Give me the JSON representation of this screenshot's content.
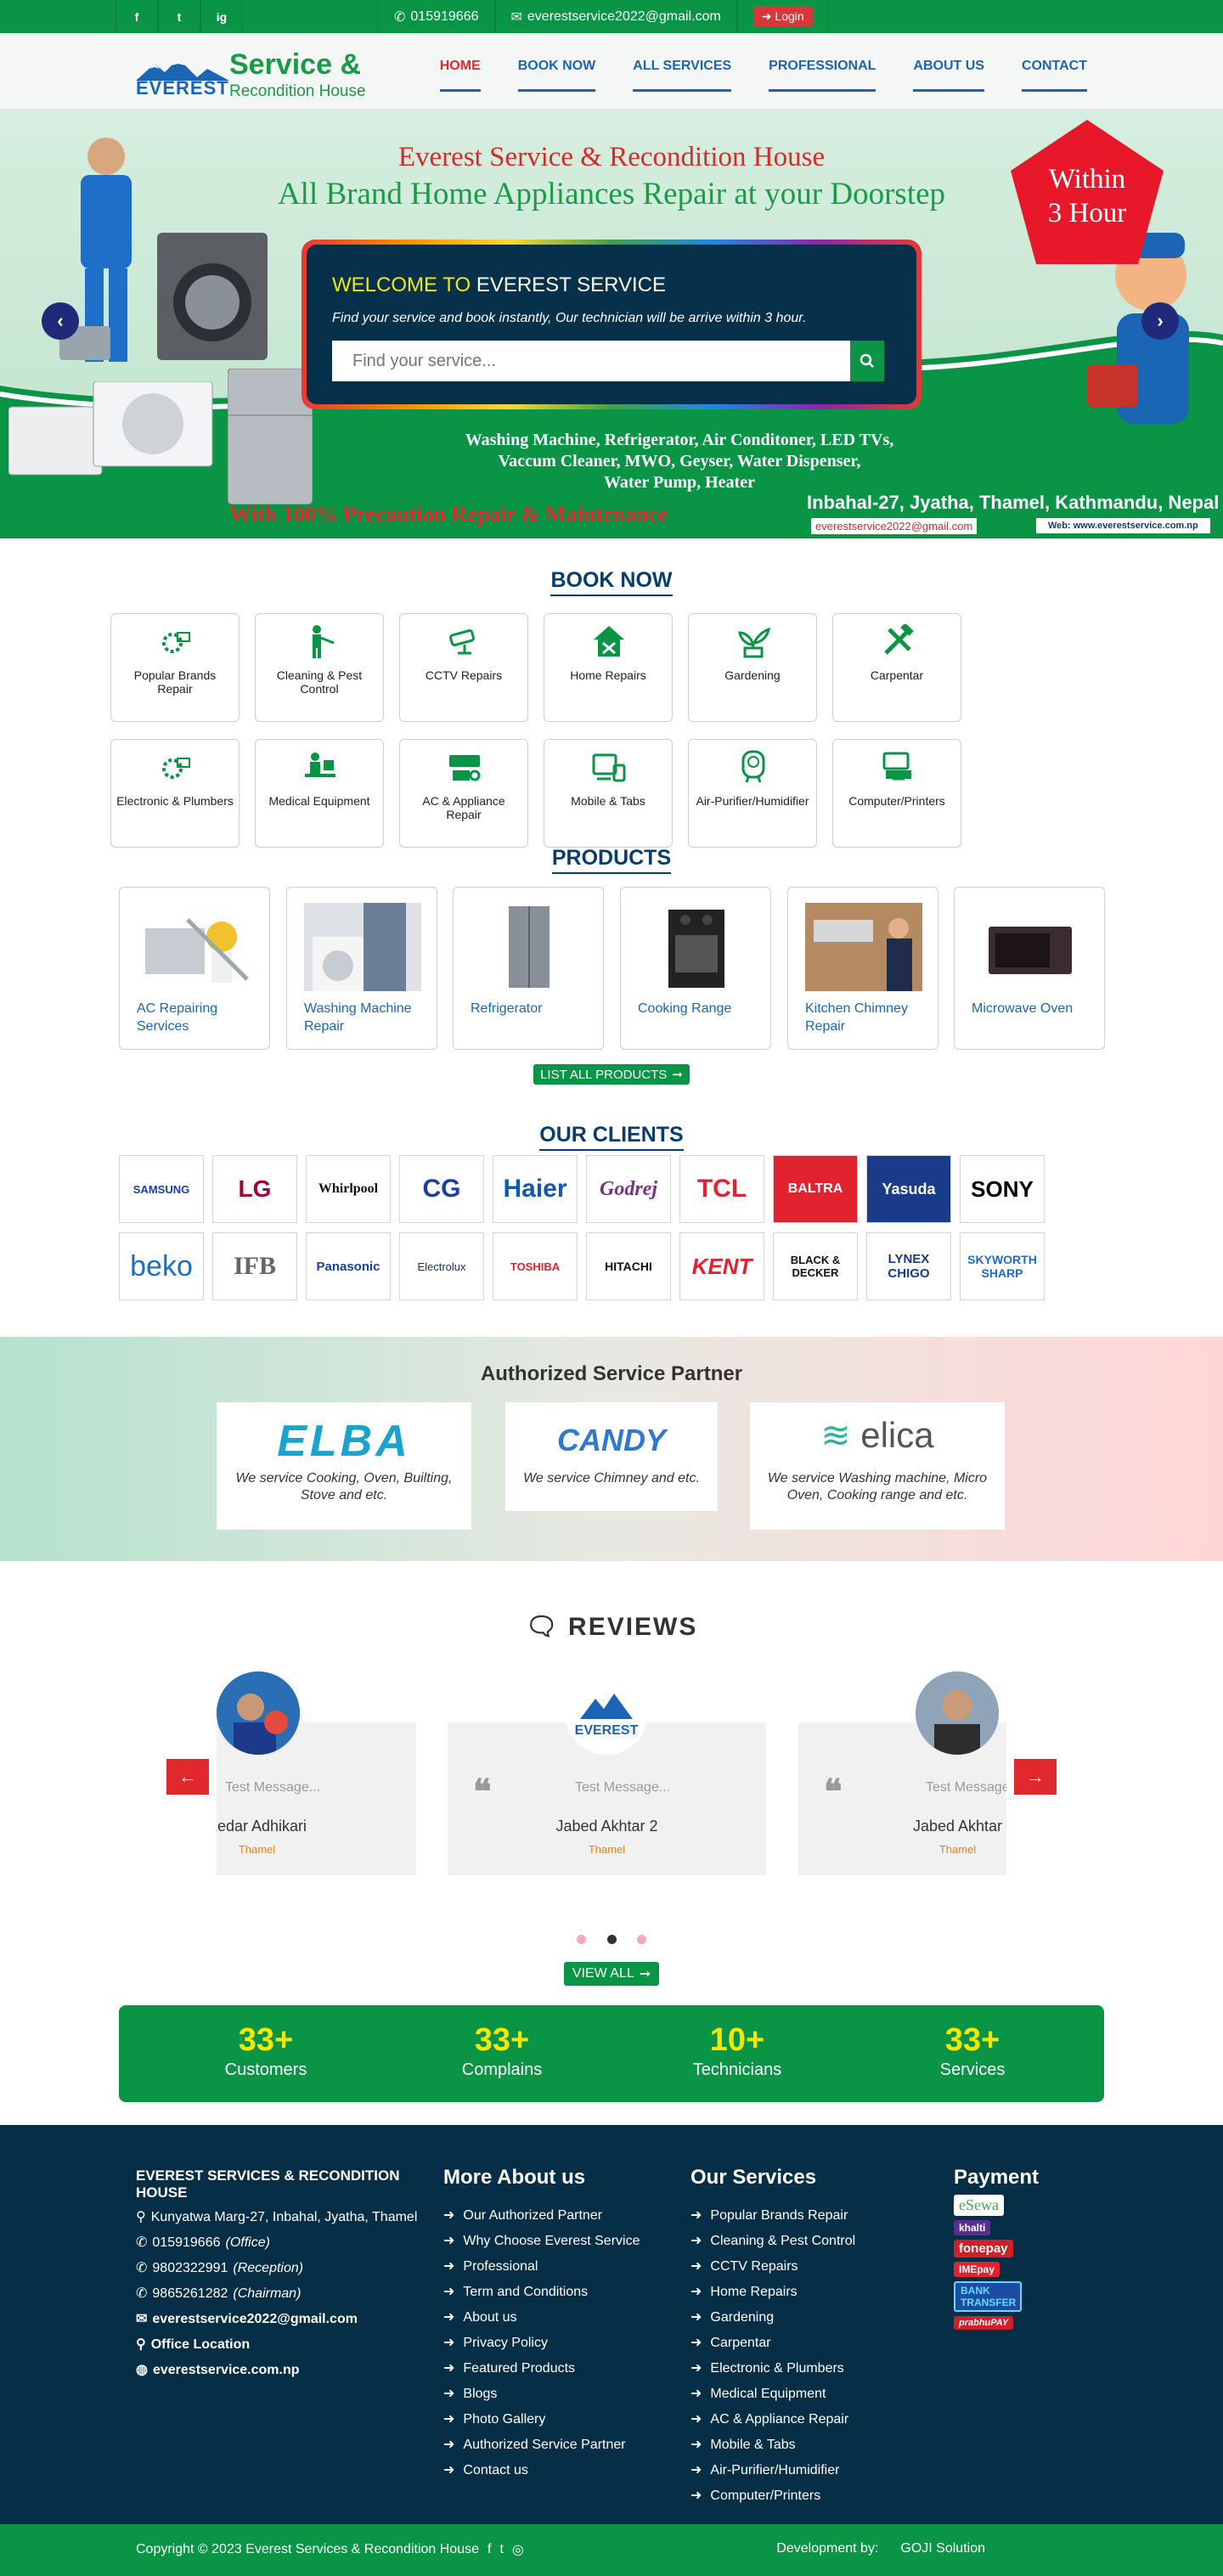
{
  "topbar": {
    "social": [
      "f",
      "t",
      "ig"
    ],
    "phone": "015919666",
    "email": "everestservice2022@gmail.com",
    "login": "Login"
  },
  "brand": {
    "line1": "Service &",
    "line2": "EVEREST",
    "line3": "Recondition House"
  },
  "nav": [
    "HOME",
    "BOOK NOW",
    "ALL SERVICES",
    "PROFESSIONAL",
    "ABOUT US",
    "CONTACT"
  ],
  "hero": {
    "title1": "Everest Service & Recondition House",
    "title2": "All Brand Home Appliances Repair at your Doorstep",
    "badge1": "Within",
    "badge2": "3 Hour",
    "welcome_prefix": "WELCOME TO",
    "welcome_name": "EVEREST SERVICE",
    "welcome_text": "Find your service and book instantly, Our technician will be arrive within 3 hour.",
    "search_placeholder": "Find your service...",
    "services_line1": "Washing Machine, Refrigerator, Air Conditoner, LED TVs,",
    "services_line2": "Vaccum Cleaner, MWO, Geyser, Water Dispenser,",
    "services_line3": "Water Pump, Heater",
    "precaution": "With 100% Precaution Repair & Maintenance",
    "address": "Inbahal-27, Jyatha, Thamel, Kathmandu, Nepal",
    "email": "everestservice2022@gmail.com",
    "web": "Web: www.everestservice.com.np"
  },
  "book_now": {
    "title": "BOOK NOW",
    "items": [
      "Popular Brands Repair",
      "Cleaning & Pest Control",
      "CCTV Repairs",
      "Home Repairs",
      "Gardening",
      "Carpentar",
      "Electronic & Plumbers",
      "Medical Equipment",
      "AC & Appliance Repair",
      "Mobile & Tabs",
      "Air-Purifier/Humidifier",
      "Computer/Printers"
    ]
  },
  "products": {
    "title": "PRODUCTS",
    "items": [
      "AC Repairing Services",
      "Washing Machine Repair",
      "Refrigerator",
      "Cooking Range",
      "Kitchen Chimney Repair",
      "Microwave Oven"
    ],
    "button": "LIST ALL PRODUCTS"
  },
  "clients": {
    "title": "OUR CLIENTS",
    "logos": [
      "SAMSUNG",
      "LG",
      "Whirlpool",
      "CG",
      "Haier",
      "Godrej",
      "TCL",
      "BALTRA",
      "Yasuda",
      "SONY",
      "beko",
      "IFB",
      "Panasonic",
      "Electrolux",
      "TOSHIBA",
      "HITACHI",
      "KENT",
      "BLACK & DECKER",
      "LYNEX CHIGO",
      "SKYWORTH SHARP"
    ]
  },
  "authorized": {
    "title": "Authorized Service Partner",
    "partners": [
      {
        "brand": "ELBA",
        "text": "We service Cooking, Oven, Builting, Stove and etc."
      },
      {
        "brand": "CANDY",
        "text": "We service Chimney and etc."
      },
      {
        "brand": "elica",
        "text": "We service Washing machine, Micro Oven, Cooking range and etc."
      }
    ]
  },
  "reviews": {
    "title": "REVIEWS",
    "cards": [
      {
        "message": "Test Message...",
        "name": "Kedar Adhikari",
        "location": "Thamel"
      },
      {
        "message": "Test Message...",
        "name": "Jabed Akhtar 2",
        "location": "Thamel"
      },
      {
        "message": "Test Message...",
        "name": "Jabed Akhtar",
        "location": "Thamel"
      }
    ],
    "view_all": "VIEW ALL"
  },
  "stats": [
    {
      "value": "33+",
      "label": "Customers"
    },
    {
      "value": "33+",
      "label": "Complains"
    },
    {
      "value": "10+",
      "label": "Technicians"
    },
    {
      "value": "33+",
      "label": "Services"
    }
  ],
  "footer": {
    "company": "EVEREST SERVICES & RECONDITION HOUSE",
    "address": "Kunyatwa Marg-27, Inbahal, Jyatha, Thamel",
    "phones": [
      {
        "num": "015919666",
        "role": "(Office)"
      },
      {
        "num": "9802322991",
        "role": "(Reception)"
      },
      {
        "num": "9865261282",
        "role": "(Chairman)"
      }
    ],
    "email": "everestservice2022@gmail.com",
    "office": "Office Location",
    "site": "everestservice.com.np",
    "more_title": "More About us",
    "more": [
      "Our Authorized Partner",
      "Why Choose Everest Service",
      "Professional",
      "Term and Conditions",
      "About us",
      "Privacy Policy",
      "Featured Products",
      "Blogs",
      "Photo Gallery",
      "Authorized Service Partner",
      "Contact us"
    ],
    "services_title": "Our Services",
    "services": [
      "Popular Brands Repair",
      "Cleaning & Pest Control",
      "CCTV Repairs",
      "Home Repairs",
      "Gardening",
      "Carpentar",
      "Electronic & Plumbers",
      "Medical Equipment",
      "AC & Appliance Repair",
      "Mobile & Tabs",
      "Air-Purifier/Humidifier",
      "Computer/Printers"
    ],
    "payment_title": "Payment",
    "payments": [
      "eSewa",
      "khalti",
      "fonepay",
      "IMEpay",
      "BANK TRANSFER",
      "prabhuPAY"
    ]
  },
  "copyright": {
    "text": "Copyright © 2023 Everest Services & Recondition House",
    "dev_label": "Development by:",
    "dev_name": "GOJI Solution"
  },
  "colors": {
    "primary_green": "#0a9445",
    "navy": "#062e47",
    "blue": "#1a66b4",
    "red": "#e0282d"
  }
}
